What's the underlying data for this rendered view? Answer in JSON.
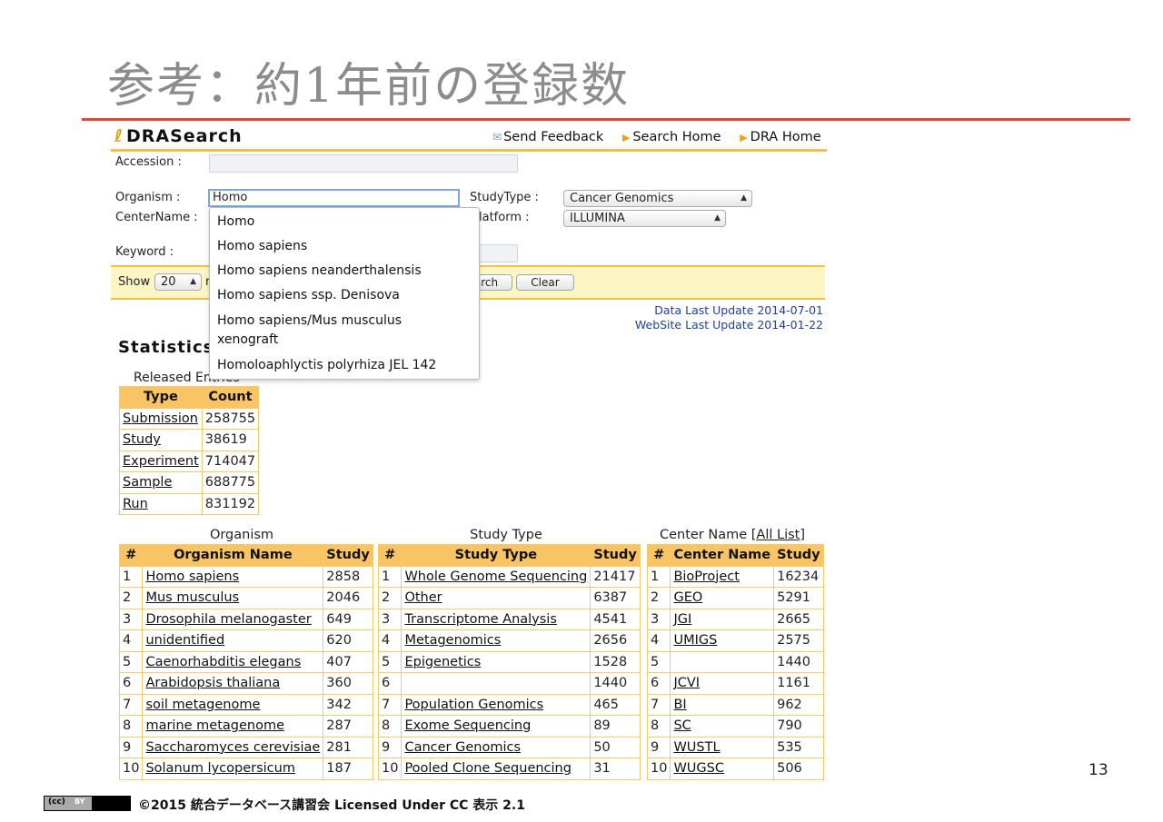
{
  "slide": {
    "title": "参考：約1年前の登録数",
    "page_number": "13",
    "footer": "©2015 統合データベース講習会 Licensed Under CC 表示 2.1",
    "cc_badge": {
      "left": "(cc)",
      "right": "BY"
    }
  },
  "header": {
    "logo": "DRASearch",
    "send_feedback": "Send Feedback",
    "search_home": "Search Home",
    "dra_home": "DRA Home"
  },
  "form": {
    "accession_label": "Accession :",
    "organism_label": "Organism :",
    "organism_value": "Homo",
    "centername_label": "CenterName :",
    "keyword_label": "Keyword :",
    "studytype_label": "StudyType :",
    "studytype_value": "Cancer Genomics",
    "platform_label": "Platform :",
    "platform_label_visible": "latform :",
    "platform_value": "ILLUMINA",
    "show_label": "Show",
    "show_value": "20",
    "show_suffix": "r",
    "search_button_visible": "arch",
    "clear_button": "Clear"
  },
  "autocomplete": [
    "Homo",
    "Homo sapiens",
    "Homo sapiens neanderthalensis",
    "Homo sapiens ssp. Denisova",
    "Homo sapiens/Mus musculus",
    "xenograft",
    "Homoloaphlyctis polyrhiza JEL 142"
  ],
  "updates": {
    "data": "Data Last Update 2014-07-01",
    "website": "WebSite Last Update 2014-01-22"
  },
  "statistics": {
    "title": "Statistics",
    "released_label": "Released Entries",
    "released_headers": [
      "Type",
      "Count"
    ],
    "released_rows": [
      [
        "Submission",
        "258755"
      ],
      [
        "Study",
        "38619"
      ],
      [
        "Experiment",
        "714047"
      ],
      [
        "Sample",
        "688775"
      ],
      [
        "Run",
        "831192"
      ]
    ]
  },
  "organism_table": {
    "caption": "Organism",
    "headers": [
      "#",
      "Organism Name",
      "Study"
    ],
    "rows": [
      [
        "1",
        "Homo sapiens",
        "2858"
      ],
      [
        "2",
        "Mus musculus",
        "2046"
      ],
      [
        "3",
        "Drosophila melanogaster",
        "649"
      ],
      [
        "4",
        "unidentified",
        "620"
      ],
      [
        "5",
        "Caenorhabditis elegans",
        "407"
      ],
      [
        "6",
        "Arabidopsis thaliana",
        "360"
      ],
      [
        "7",
        "soil metagenome",
        "342"
      ],
      [
        "8",
        "marine metagenome",
        "287"
      ],
      [
        "9",
        "Saccharomyces cerevisiae",
        "281"
      ],
      [
        "10",
        "Solanum lycopersicum",
        "187"
      ]
    ]
  },
  "studytype_table": {
    "caption": "Study Type",
    "headers": [
      "#",
      "Study Type",
      "Study"
    ],
    "rows": [
      [
        "1",
        "Whole Genome Sequencing",
        "21417"
      ],
      [
        "2",
        "Other",
        "6387"
      ],
      [
        "3",
        "Transcriptome Analysis",
        "4541"
      ],
      [
        "4",
        "Metagenomics",
        "2656"
      ],
      [
        "5",
        "Epigenetics",
        "1528"
      ],
      [
        "6",
        "",
        "1440"
      ],
      [
        "7",
        "Population Genomics",
        "465"
      ],
      [
        "8",
        "Exome Sequencing",
        "89"
      ],
      [
        "9",
        "Cancer Genomics",
        "50"
      ],
      [
        "10",
        "Pooled Clone Sequencing",
        "31"
      ]
    ]
  },
  "center_table": {
    "caption": "Center Name [",
    "caption_link": "All List",
    "caption_end": "]",
    "headers": [
      "#",
      "Center Name",
      "Study"
    ],
    "rows": [
      [
        "1",
        "BioProject",
        "16234"
      ],
      [
        "2",
        "GEO",
        "5291"
      ],
      [
        "3",
        "JGI",
        "2665"
      ],
      [
        "4",
        "UMIGS",
        "2575"
      ],
      [
        "5",
        "",
        "1440"
      ],
      [
        "6",
        "JCVI",
        "1161"
      ],
      [
        "7",
        "BI",
        "962"
      ],
      [
        "8",
        "SC",
        "790"
      ],
      [
        "9",
        "WUSTL",
        "535"
      ],
      [
        "10",
        "WUGSC",
        "506"
      ]
    ]
  },
  "colors": {
    "title_gray": "#8c8c8c",
    "red_rule": "#e2472d",
    "header_yellow": "#f9c463",
    "bar_yellow": "#fdf6c3",
    "link_blue": "#1d3fa0"
  }
}
